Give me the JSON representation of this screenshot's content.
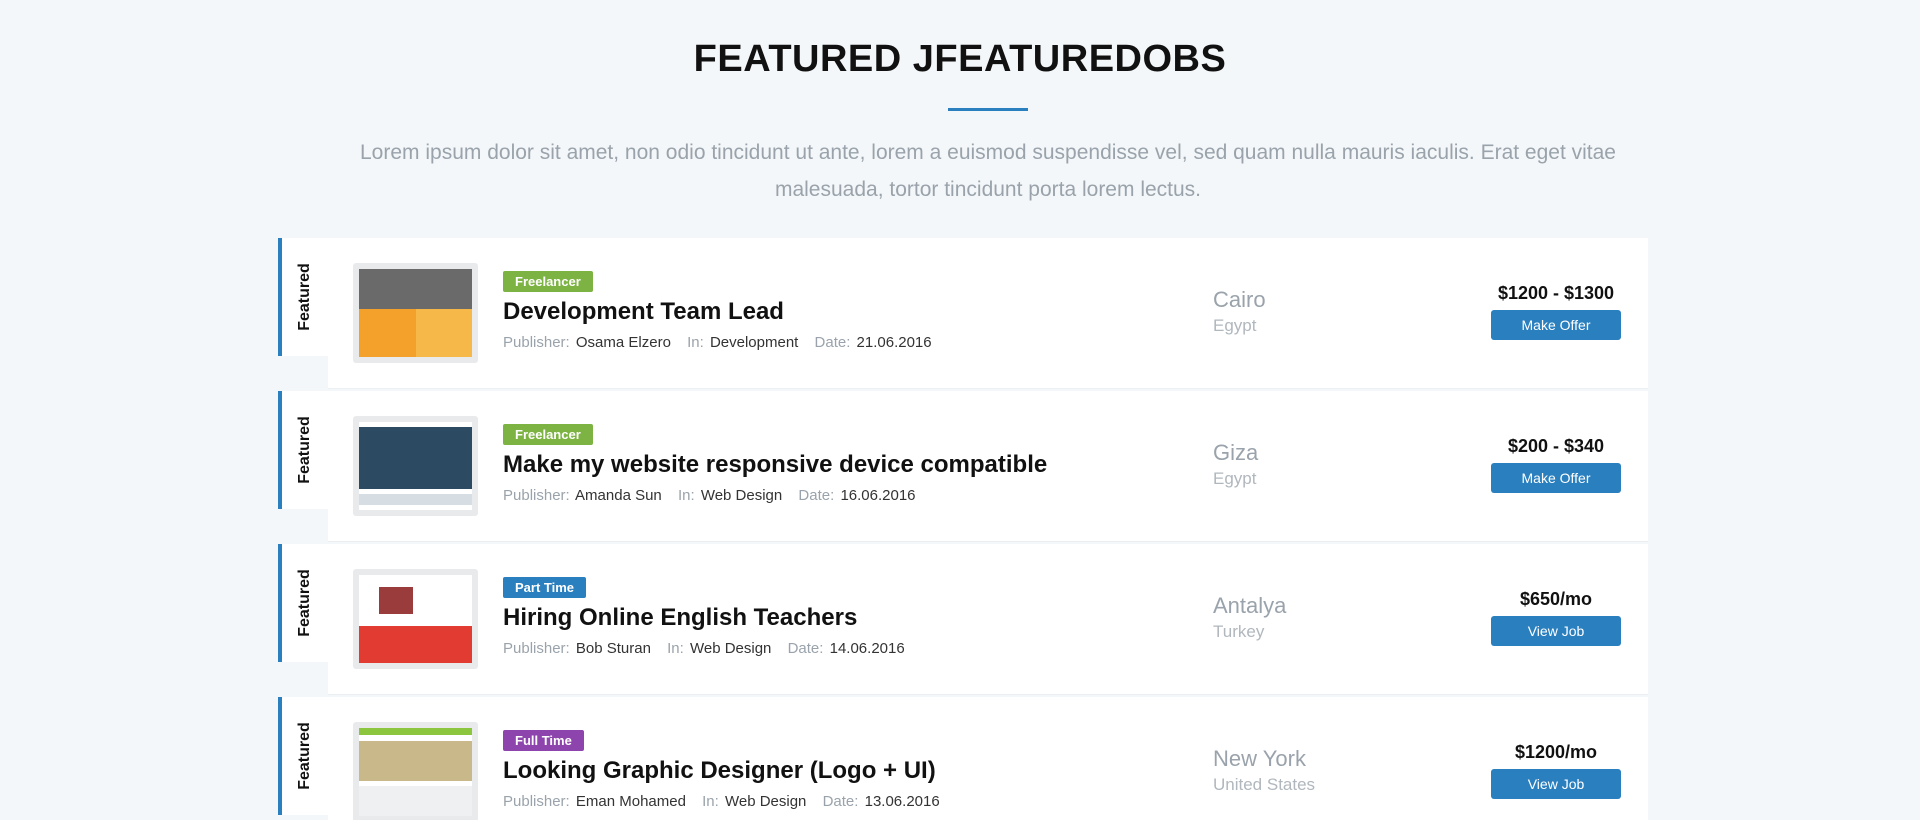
{
  "header": {
    "title": "FEATURED JFEATUREDOBS",
    "intro": "Lorem ipsum dolor sit amet, non odio tincidunt ut ante, lorem a euismod suspendisse vel, sed quam nulla mauris iaculis. Erat eget vitae malesuada, tortor tincidunt porta lorem lectus."
  },
  "labels": {
    "featured": "Featured",
    "publisher": "Publisher:",
    "in": "In:",
    "date": "Date:"
  },
  "colors": {
    "accent": "#2a7fbf",
    "freelancer": "#7cb342",
    "part_time": "#2a7fbf",
    "full_time": "#8e44ad"
  },
  "jobs": [
    {
      "badge": "Freelancer",
      "badge_color": "#7cb342",
      "title": "Development Team Lead",
      "publisher": "Osama Elzero",
      "category": "Development",
      "date": "21.06.2016",
      "city": "Cairo",
      "country": "Egypt",
      "price": "$1200 - $1300",
      "action": "Make Offer"
    },
    {
      "badge": "Freelancer",
      "badge_color": "#7cb342",
      "title": "Make my website responsive device compatible",
      "publisher": "Amanda Sun",
      "category": "Web Design",
      "date": "16.06.2016",
      "city": "Giza",
      "country": "Egypt",
      "price": "$200 - $340",
      "action": "Make Offer"
    },
    {
      "badge": "Part Time",
      "badge_color": "#2a7fbf",
      "title": "Hiring Online English Teachers",
      "publisher": "Bob Sturan",
      "category": "Web Design",
      "date": "14.06.2016",
      "city": "Antalya",
      "country": "Turkey",
      "price": "$650/mo",
      "action": "View Job"
    },
    {
      "badge": "Full Time",
      "badge_color": "#8e44ad",
      "title": "Looking Graphic Designer (Logo + UI)",
      "publisher": "Eman Mohamed",
      "category": "Web Design",
      "date": "13.06.2016",
      "city": "New York",
      "country": "United States",
      "price": "$1200/mo",
      "action": "View Job"
    }
  ]
}
